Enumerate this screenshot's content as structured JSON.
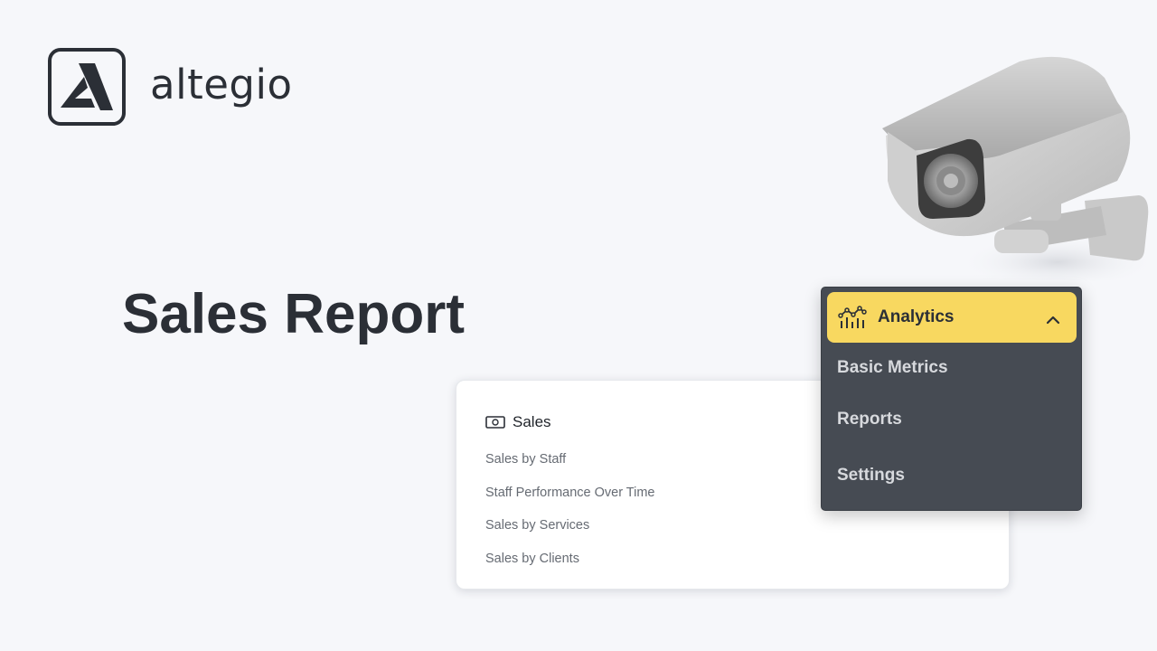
{
  "brand": {
    "name": "altegio"
  },
  "title": "Sales Report",
  "sales_card": {
    "icon": "money-icon",
    "title": "Sales",
    "items": [
      "Sales by Staff",
      "Staff Performance Over Time",
      "Sales by Services",
      "Sales by Clients"
    ]
  },
  "menu": {
    "header": {
      "icon": "analytics-icon",
      "label": "Analytics",
      "chevron": "chevron-up-icon"
    },
    "items": [
      "Basic Metrics",
      "Reports",
      "Settings"
    ],
    "accent": "#f8d860",
    "background": "#464b53"
  },
  "colors": {
    "page_background": "#f6f7fa",
    "text_dark": "#2b2f36"
  }
}
